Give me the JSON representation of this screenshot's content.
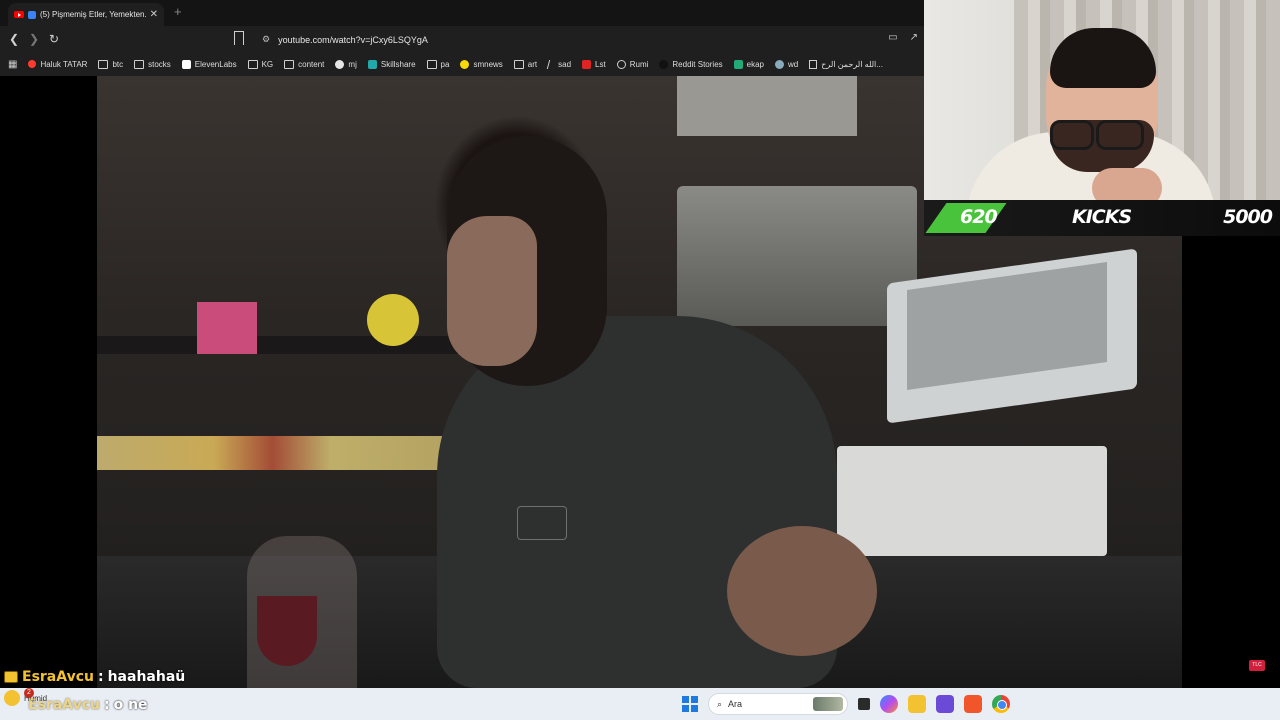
{
  "browser": {
    "tab": {
      "title": "(5) Pişmemiş Etler, Yemekten..."
    },
    "omnibox": {
      "url": "youtube.com/watch?v=jCxy6LSQYgA"
    },
    "bookmarks": [
      {
        "label": "Haluk TATAR",
        "icon": "red-dot-icon"
      },
      {
        "label": "btc",
        "icon": "folder-icon"
      },
      {
        "label": "stocks",
        "icon": "folder-icon"
      },
      {
        "label": "ElevenLabs",
        "icon": "elevenlabs-icon"
      },
      {
        "label": "KG",
        "icon": "folder-icon"
      },
      {
        "label": "content",
        "icon": "folder-icon"
      },
      {
        "label": "mj",
        "icon": "github-icon"
      },
      {
        "label": "Skillshare",
        "icon": "skillshare-icon"
      },
      {
        "label": "pa",
        "icon": "folder-icon"
      },
      {
        "label": "smnews",
        "icon": "smile-icon"
      },
      {
        "label": "art",
        "icon": "folder-icon"
      },
      {
        "label": "sad",
        "icon": "v-icon"
      },
      {
        "label": "Lst",
        "icon": "lst-icon"
      },
      {
        "label": "Rumi",
        "icon": "globe-icon"
      },
      {
        "label": "Reddit Stories",
        "icon": "d-icon"
      },
      {
        "label": "ekap",
        "icon": "ekap-icon"
      },
      {
        "label": "wd",
        "icon": "wd-icon"
      },
      {
        "label": "الله الرحمن الرح...",
        "icon": "book-icon"
      }
    ]
  },
  "overlay": {
    "kicks_count": "620",
    "kicks_label": "KICKS",
    "kicks_goal": "5000",
    "kicks_progress": 0.124
  },
  "chat": {
    "line1": {
      "user": "EsraAvcu",
      "sep": ":",
      "message": "haahahaü"
    },
    "line2": {
      "user": "EsraAvcu",
      "sep": ":",
      "message": "o ne"
    }
  },
  "taskbar": {
    "weather_text": "Humid",
    "notif_count": "2",
    "search_placeholder": "Ara"
  },
  "colors": {
    "kicks_green": "#4ac33c",
    "chat_username": "#f2c230",
    "youtube_red": "#ff0000"
  }
}
